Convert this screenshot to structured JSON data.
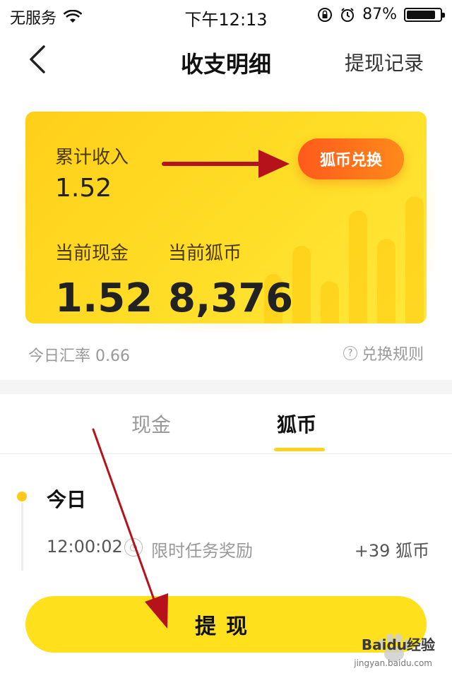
{
  "status_bar": {
    "carrier": "无服务",
    "time": "下午12:13",
    "battery_percent": "87%",
    "battery_level": 0.87
  },
  "nav": {
    "title": "收支明细",
    "right_action": "提现记录"
  },
  "summary": {
    "total_income_label": "累计收入",
    "total_income_value": "1.52",
    "exchange_button": "狐币兑换",
    "cash_label": "当前现金",
    "cash_value": "1.52",
    "coin_label": "当前狐币",
    "coin_value": "8,376",
    "rate_text": "今日汇率 0.66",
    "rules_text": "兑换规则"
  },
  "tabs": [
    {
      "label": "现金",
      "active": false
    },
    {
      "label": "狐币",
      "active": true
    }
  ],
  "records": {
    "day_label": "今日",
    "items": [
      {
        "time": "12:00:02",
        "icon": "clock-badge-icon",
        "description": "限时任务奖励",
        "amount": "+39 狐币"
      }
    ]
  },
  "withdraw_button": "提现",
  "watermark": {
    "brand": "Baidu经验",
    "url": "jingyan.baidu.com"
  },
  "colors": {
    "card_yellow": "#ffd21f",
    "exchange_orange": "#ff5a1c",
    "annotation_arrow": "#b5121b",
    "button_yellow": "#ffe01c"
  }
}
